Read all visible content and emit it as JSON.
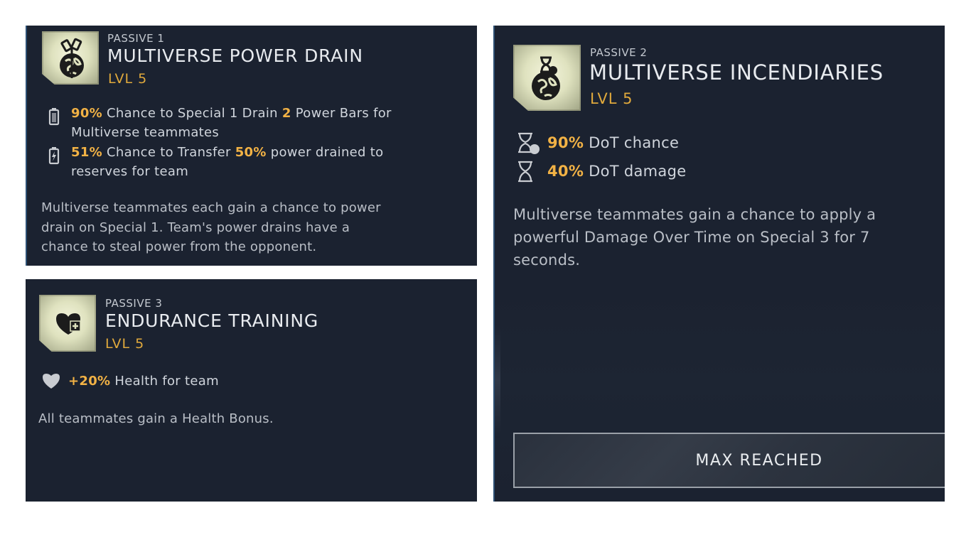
{
  "passives": [
    {
      "label": "PASSIVE 1",
      "title": "MULTIVERSE POWER DRAIN",
      "level": "LVL 5",
      "badge_icon": "globe-power-drain-icon",
      "stats": [
        {
          "icon": "battery-icon",
          "v1": "90%",
          "t1": "Chance to Special 1 Drain",
          "v2": "2",
          "t2": "Power Bars for",
          "t3": "Multiverse teammates"
        },
        {
          "icon": "battery-charge-icon",
          "v1": "51%",
          "t1": "Chance to Transfer",
          "v2": "50%",
          "t2": "power drained to",
          "t3": "reserves for team"
        }
      ],
      "description": [
        "Multiverse teammates each gain a chance to power",
        "drain on Special 1. Team's power drains have a",
        "chance to steal power from the opponent."
      ]
    },
    {
      "label": "PASSIVE 2",
      "title": "MULTIVERSE INCENDIARIES",
      "level": "LVL 5",
      "badge_icon": "globe-hourglass-icon",
      "stats": [
        {
          "icon": "hourglass-chance-icon",
          "value": "90%",
          "text": "DoT chance"
        },
        {
          "icon": "hourglass-icon",
          "value": "40%",
          "text": "DoT damage"
        }
      ],
      "description": [
        "Multiverse teammates gain a chance to apply a",
        "powerful Damage Over Time on Special 3 for 7",
        "seconds."
      ],
      "button": "MAX REACHED"
    },
    {
      "label": "PASSIVE 3",
      "title": "ENDURANCE TRAINING",
      "level": "LVL 5",
      "badge_icon": "heart-plus-icon",
      "stats": [
        {
          "icon": "heart-icon",
          "value": "+20%",
          "text": "Health for team"
        }
      ],
      "description": [
        "All teammates gain a Health Bonus."
      ]
    }
  ],
  "colors": {
    "panel": "#1b2230",
    "accent": "#f2b245",
    "text": "#d0d5dc",
    "badge": "#dfe2bf"
  }
}
